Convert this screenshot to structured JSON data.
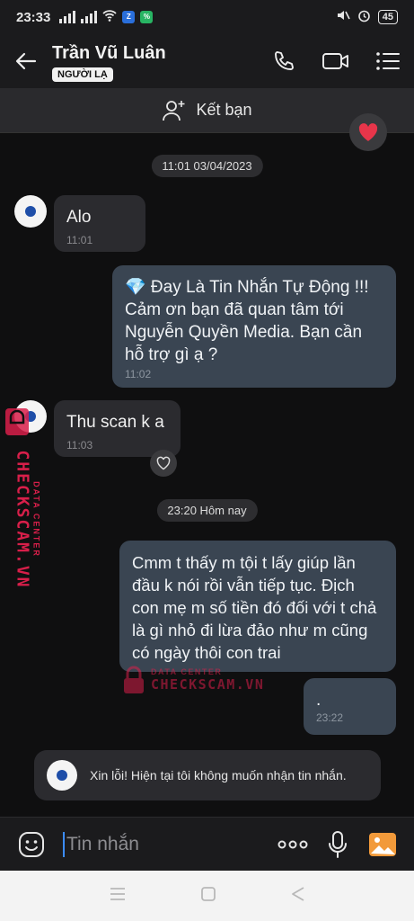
{
  "status": {
    "time": "23:33",
    "battery": "45"
  },
  "header": {
    "name": "Trần Vũ Luân",
    "badge": "NGƯỜI LẠ"
  },
  "friend_bar": {
    "label": "Kết bạn"
  },
  "messages": [
    {
      "date": "11:01 03/04/2023"
    },
    {
      "from": "contact",
      "text": "Alo",
      "time": "11:01"
    },
    {
      "from": "me",
      "text": "💎 Đay Là Tin Nhắn Tự Động !!! Cảm ơn bạn đã quan tâm tới Nguyễn Quyền Media. Bạn cần hỗ trợ gì ạ ?",
      "time": "11:02"
    },
    {
      "from": "contact",
      "text": "Thu scan k a",
      "time": "11:03"
    },
    {
      "date": "23:20 Hôm nay"
    },
    {
      "from": "me",
      "text": "Cmm t thấy m tội t lấy giúp lần đầu k nói rồi vẫn tiếp tục. Địch con mẹ m số tiền đó đối với t chả là gì nhỏ đi lừa đảo như m cũng có ngày thôi con trai"
    },
    {
      "from": "me",
      "text": ".",
      "time": "23:22"
    }
  ],
  "notice": {
    "text": "Xin lỗi! Hiện tại tôi không muốn nhận tin nhắn."
  },
  "composer": {
    "placeholder": "Tin nhắn"
  },
  "watermark": {
    "small": "DATA CENTER",
    "big": "CHECKSCAM.VN"
  },
  "colors": {
    "accent": "#3b8cff",
    "heart": "#e8354a",
    "watermark": "#d81f4a"
  }
}
